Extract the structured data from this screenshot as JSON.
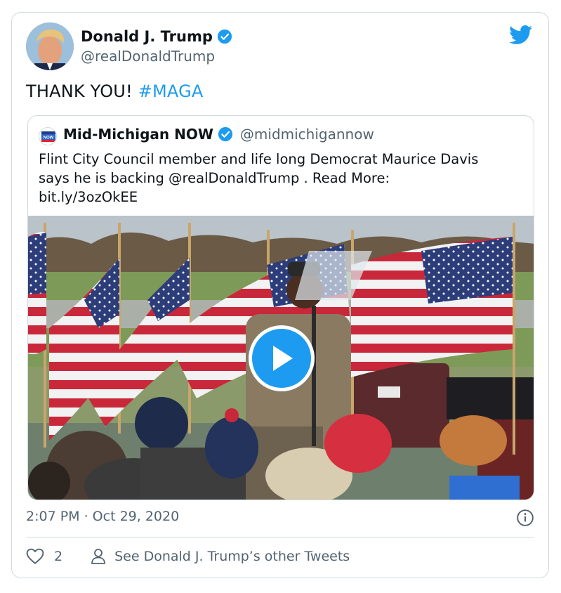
{
  "tweet": {
    "author_name": "Donald J. Trump",
    "author_handle": "@realDonaldTrump",
    "text_main": "THANK YOU!",
    "hashtag": "#MAGA",
    "timestamp": "2:07 PM · Oct 29, 2020",
    "like_count": "2",
    "other_tweets_label": "See Donald J. Trump’s other Tweets"
  },
  "quoted": {
    "author_name": "Mid-Michigan NOW",
    "author_handle": "@midmichigannow",
    "text_line1": "Flint City Council member and life long Democrat Maurice Davis",
    "text_line2": "says he is backing @realDonaldTrump . Read More:",
    "text_line3": "bit.ly/3ozOkEE",
    "logo_text": "NOW"
  },
  "icons": {
    "verified": "verified-badge-icon",
    "brand": "twitter-bird-icon",
    "play": "play-icon",
    "info": "info-icon",
    "like": "heart-icon",
    "profile": "person-icon"
  },
  "colors": {
    "accent": "#1d9bf0",
    "text": "#0f1419",
    "secondary": "#536471",
    "border": "#cfd9de"
  }
}
